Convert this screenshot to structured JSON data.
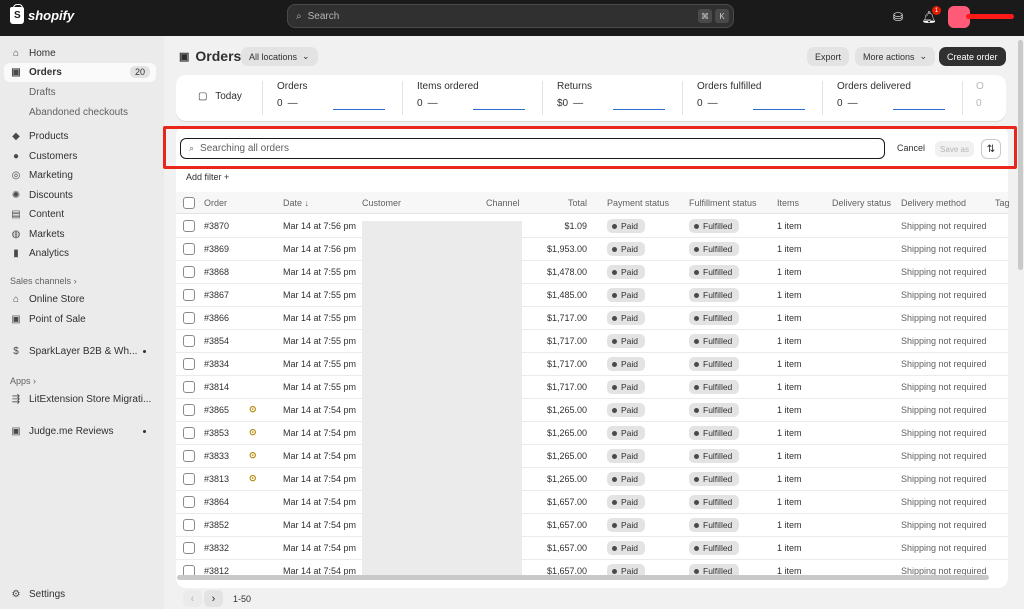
{
  "app": {
    "logo_text": "shopify"
  },
  "topbar": {
    "search_placeholder": "Search",
    "shortcut_keys": [
      "⌘",
      "K"
    ],
    "notification_count": "1"
  },
  "sidebar": {
    "items": [
      {
        "label": "Home",
        "icon": "home-icon"
      },
      {
        "label": "Orders",
        "icon": "orders-icon",
        "count": "20",
        "active": true
      },
      {
        "label": "Drafts"
      },
      {
        "label": "Abandoned checkouts"
      },
      {
        "label": "Products",
        "icon": "tag-icon"
      },
      {
        "label": "Customers",
        "icon": "person-icon"
      },
      {
        "label": "Marketing",
        "icon": "target-icon"
      },
      {
        "label": "Discounts",
        "icon": "discount-icon"
      },
      {
        "label": "Content",
        "icon": "content-icon"
      },
      {
        "label": "Markets",
        "icon": "globe-icon"
      },
      {
        "label": "Analytics",
        "icon": "chart-icon"
      }
    ],
    "sales_channels_heading": "Sales channels",
    "sales_channels": [
      "Online Store",
      "Point of Sale"
    ],
    "app_pinned": "SparkLayer B2B & Wh...",
    "apps_heading": "Apps",
    "apps": [
      "LitExtension Store Migrati...",
      "Judge.me Reviews"
    ],
    "settings": "Settings"
  },
  "header": {
    "title": "Orders",
    "location_filter": "All locations",
    "export": "Export",
    "more_actions": "More actions",
    "create_order": "Create order"
  },
  "stats": {
    "period": "Today",
    "items": [
      {
        "label": "Orders",
        "value": "0"
      },
      {
        "label": "Items ordered",
        "value": "0"
      },
      {
        "label": "Returns",
        "value": "$0"
      },
      {
        "label": "Orders fulfilled",
        "value": "0"
      },
      {
        "label": "Orders delivered",
        "value": "0"
      }
    ],
    "dash": "—",
    "cut_label": "O",
    "cut_value": "0"
  },
  "filters": {
    "search_placeholder": "Searching all orders",
    "cancel": "Cancel",
    "save_as": "Save as",
    "add_filter": "Add filter +"
  },
  "table": {
    "columns": [
      "Order",
      "Date ↓",
      "Customer",
      "Channel",
      "Total",
      "Payment status",
      "Fulfillment status",
      "Items",
      "Delivery status",
      "Delivery method",
      "Tag"
    ],
    "rows": [
      {
        "order": "#3870",
        "date": "Mar 14 at 7:56 pm",
        "total": "$1.09",
        "payment": "Paid",
        "fulfillment": "Fulfilled",
        "items": "1 item",
        "method": "Shipping not required",
        "warn": false
      },
      {
        "order": "#3869",
        "date": "Mar 14 at 7:56 pm",
        "total": "$1,953.00",
        "payment": "Paid",
        "fulfillment": "Fulfilled",
        "items": "1 item",
        "method": "Shipping not required",
        "warn": false
      },
      {
        "order": "#3868",
        "date": "Mar 14 at 7:55 pm",
        "total": "$1,478.00",
        "payment": "Paid",
        "fulfillment": "Fulfilled",
        "items": "1 item",
        "method": "Shipping not required",
        "warn": false
      },
      {
        "order": "#3867",
        "date": "Mar 14 at 7:55 pm",
        "total": "$1,485.00",
        "payment": "Paid",
        "fulfillment": "Fulfilled",
        "items": "1 item",
        "method": "Shipping not required",
        "warn": false
      },
      {
        "order": "#3866",
        "date": "Mar 14 at 7:55 pm",
        "total": "$1,717.00",
        "payment": "Paid",
        "fulfillment": "Fulfilled",
        "items": "1 item",
        "method": "Shipping not required",
        "warn": false
      },
      {
        "order": "#3854",
        "date": "Mar 14 at 7:55 pm",
        "total": "$1,717.00",
        "payment": "Paid",
        "fulfillment": "Fulfilled",
        "items": "1 item",
        "method": "Shipping not required",
        "warn": false
      },
      {
        "order": "#3834",
        "date": "Mar 14 at 7:55 pm",
        "total": "$1,717.00",
        "payment": "Paid",
        "fulfillment": "Fulfilled",
        "items": "1 item",
        "method": "Shipping not required",
        "warn": false
      },
      {
        "order": "#3814",
        "date": "Mar 14 at 7:55 pm",
        "total": "$1,717.00",
        "payment": "Paid",
        "fulfillment": "Fulfilled",
        "items": "1 item",
        "method": "Shipping not required",
        "warn": false
      },
      {
        "order": "#3865",
        "date": "Mar 14 at 7:54 pm",
        "total": "$1,265.00",
        "payment": "Paid",
        "fulfillment": "Fulfilled",
        "items": "1 item",
        "method": "Shipping not required",
        "warn": true
      },
      {
        "order": "#3853",
        "date": "Mar 14 at 7:54 pm",
        "total": "$1,265.00",
        "payment": "Paid",
        "fulfillment": "Fulfilled",
        "items": "1 item",
        "method": "Shipping not required",
        "warn": true
      },
      {
        "order": "#3833",
        "date": "Mar 14 at 7:54 pm",
        "total": "$1,265.00",
        "payment": "Paid",
        "fulfillment": "Fulfilled",
        "items": "1 item",
        "method": "Shipping not required",
        "warn": true
      },
      {
        "order": "#3813",
        "date": "Mar 14 at 7:54 pm",
        "total": "$1,265.00",
        "payment": "Paid",
        "fulfillment": "Fulfilled",
        "items": "1 item",
        "method": "Shipping not required",
        "warn": true
      },
      {
        "order": "#3864",
        "date": "Mar 14 at 7:54 pm",
        "total": "$1,657.00",
        "payment": "Paid",
        "fulfillment": "Fulfilled",
        "items": "1 item",
        "method": "Shipping not required",
        "warn": false
      },
      {
        "order": "#3852",
        "date": "Mar 14 at 7:54 pm",
        "total": "$1,657.00",
        "payment": "Paid",
        "fulfillment": "Fulfilled",
        "items": "1 item",
        "method": "Shipping not required",
        "warn": false
      },
      {
        "order": "#3832",
        "date": "Mar 14 at 7:54 pm",
        "total": "$1,657.00",
        "payment": "Paid",
        "fulfillment": "Fulfilled",
        "items": "1 item",
        "method": "Shipping not required",
        "warn": false
      },
      {
        "order": "#3812",
        "date": "Mar 14 at 7:54 pm",
        "total": "$1,657.00",
        "payment": "Paid",
        "fulfillment": "Fulfilled",
        "items": "1 item",
        "method": "Shipping not required",
        "warn": false
      }
    ]
  },
  "pagination": {
    "range": "1-50",
    "prev": "‹",
    "next": "›"
  },
  "colors": {
    "topbar": "#1a1a1a",
    "highlight": "#e8261a",
    "sidebar": "#ebebeb"
  }
}
